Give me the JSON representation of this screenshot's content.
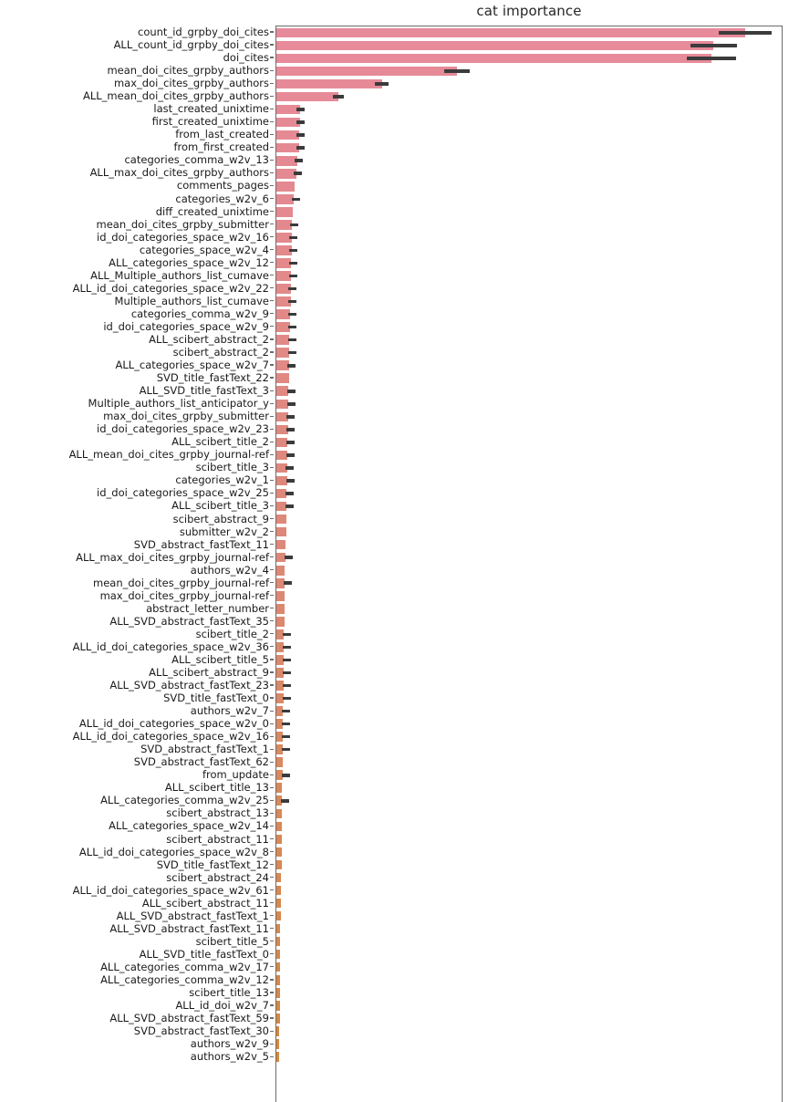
{
  "chart_data": {
    "type": "bar",
    "orientation": "horizontal",
    "title": "cat importance",
    "xlabel": "",
    "ylabel": "",
    "xlim": [
      0,
      1.0
    ],
    "grid": false,
    "legend": null,
    "note": "Horizontal feature-importance bar chart with black error bars at each bar tip; bar colors run a pink-to-orange gradient from top to bottom. Values are normalized importances read off bar lengths (axis is unlabeled / tick labels clipped below the visible area).",
    "categories": [
      "count_id_grpby_doi_cites",
      "ALL_count_id_grpby_doi_cites",
      "doi_cites",
      "mean_doi_cites_grpby_authors",
      "max_doi_cites_grpby_authors",
      "ALL_mean_doi_cites_grpby_authors",
      "last_created_unixtime",
      "first_created_unixtime",
      "from_last_created",
      "from_first_created",
      "categories_comma_w2v_13",
      "ALL_max_doi_cites_grpby_authors",
      "comments_pages",
      "categories_w2v_6",
      "diff_created_unixtime",
      "mean_doi_cites_grpby_submitter",
      "id_doi_categories_space_w2v_16",
      "categories_space_w2v_4",
      "ALL_categories_space_w2v_12",
      "ALL_Multiple_authors_list_cumave",
      "ALL_id_doi_categories_space_w2v_22",
      "Multiple_authors_list_cumave",
      "categories_comma_w2v_9",
      "id_doi_categories_space_w2v_9",
      "ALL_scibert_abstract_2",
      "scibert_abstract_2",
      "ALL_categories_space_w2v_7",
      "SVD_title_fastText_22",
      "ALL_SVD_title_fastText_3",
      "Multiple_authors_list_anticipator_y",
      "max_doi_cites_grpby_submitter",
      "id_doi_categories_space_w2v_23",
      "ALL_scibert_title_2",
      "ALL_mean_doi_cites_grpby_journal-ref",
      "scibert_title_3",
      "categories_w2v_1",
      "id_doi_categories_space_w2v_25",
      "ALL_scibert_title_3",
      "scibert_abstract_9",
      "submitter_w2v_2",
      "SVD_abstract_fastText_11",
      "ALL_max_doi_cites_grpby_journal-ref",
      "authors_w2v_4",
      "mean_doi_cites_grpby_journal-ref",
      "max_doi_cites_grpby_journal-ref",
      "abstract_letter_number",
      "ALL_SVD_abstract_fastText_35",
      "scibert_title_2",
      "ALL_id_doi_categories_space_w2v_36",
      "ALL_scibert_title_5",
      "ALL_scibert_abstract_9",
      "ALL_SVD_abstract_fastText_23",
      "SVD_title_fastText_0",
      "authors_w2v_7",
      "ALL_id_doi_categories_space_w2v_0",
      "ALL_id_doi_categories_space_w2v_16",
      "SVD_abstract_fastText_1",
      "SVD_abstract_fastText_62",
      "from_update",
      "ALL_scibert_title_13",
      "ALL_categories_comma_w2v_25",
      "scibert_abstract_13",
      "ALL_categories_space_w2v_14",
      "scibert_abstract_11",
      "ALL_id_doi_categories_space_w2v_8",
      "SVD_title_fastText_12",
      "scibert_abstract_24",
      "ALL_id_doi_categories_space_w2v_61",
      "ALL_scibert_abstract_11",
      "ALL_SVD_abstract_fastText_1",
      "ALL_SVD_abstract_fastText_11",
      "scibert_title_5",
      "ALL_SVD_title_fastText_0",
      "ALL_categories_comma_w2v_17",
      "ALL_categories_comma_w2v_12",
      "scibert_title_13",
      "ALL_id_doi_w2v_7",
      "ALL_SVD_abstract_fastText_59",
      "SVD_abstract_fastText_30",
      "authors_w2v_9",
      "authors_w2v_5"
    ],
    "values": [
      0.925,
      0.862,
      0.858,
      0.356,
      0.208,
      0.122,
      0.046,
      0.046,
      0.045,
      0.045,
      0.041,
      0.04,
      0.036,
      0.034,
      0.033,
      0.031,
      0.03,
      0.03,
      0.029,
      0.029,
      0.028,
      0.028,
      0.027,
      0.027,
      0.026,
      0.026,
      0.025,
      0.025,
      0.024,
      0.024,
      0.023,
      0.023,
      0.022,
      0.022,
      0.021,
      0.021,
      0.02,
      0.02,
      0.019,
      0.019,
      0.018,
      0.018,
      0.017,
      0.017,
      0.017,
      0.016,
      0.016,
      0.015,
      0.015,
      0.015,
      0.014,
      0.014,
      0.014,
      0.013,
      0.013,
      0.013,
      0.012,
      0.012,
      0.012,
      0.011,
      0.011,
      0.011,
      0.01,
      0.01,
      0.01,
      0.01,
      0.009,
      0.009,
      0.009,
      0.009,
      0.008,
      0.008,
      0.008,
      0.008,
      0.007,
      0.007,
      0.007,
      0.007,
      0.006,
      0.006,
      0.006
    ],
    "errors": [
      0.052,
      0.046,
      0.048,
      0.025,
      0.014,
      0.011,
      0.006,
      0.006,
      0.006,
      0.006,
      0.005,
      0.005,
      0.0,
      0.004,
      0.0,
      0.004,
      0.004,
      0.004,
      0.004,
      0.004,
      0.004,
      0.004,
      0.003,
      0.003,
      0.003,
      0.003,
      0.003,
      0.0,
      0.003,
      0.003,
      0.003,
      0.003,
      0.003,
      0.003,
      0.003,
      0.002,
      0.002,
      0.002,
      0.0,
      0.0,
      0.0,
      0.002,
      0.0,
      0.002,
      0.0,
      0.0,
      0.0,
      0.002,
      0.002,
      0.002,
      0.002,
      0.002,
      0.002,
      0.002,
      0.002,
      0.002,
      0.002,
      0.0,
      0.002,
      0.0,
      0.002,
      0.0,
      0.0,
      0.0,
      0.0,
      0.0,
      0.0,
      0.0,
      0.0,
      0.0,
      0.0,
      0.0,
      0.0,
      0.0,
      0.0,
      0.0,
      0.0,
      0.0,
      0.0,
      0.0,
      0.0
    ],
    "colors": {
      "bar_top": "#e78a9b",
      "bar_mid": "#dd8878",
      "bar_bottom": "#d5883d",
      "error_bar": "#3b3b3b",
      "axis": "#6b6b6b",
      "title_text": "#262626",
      "tick_label": "#1a1a1a",
      "background": "#ffffff"
    }
  }
}
